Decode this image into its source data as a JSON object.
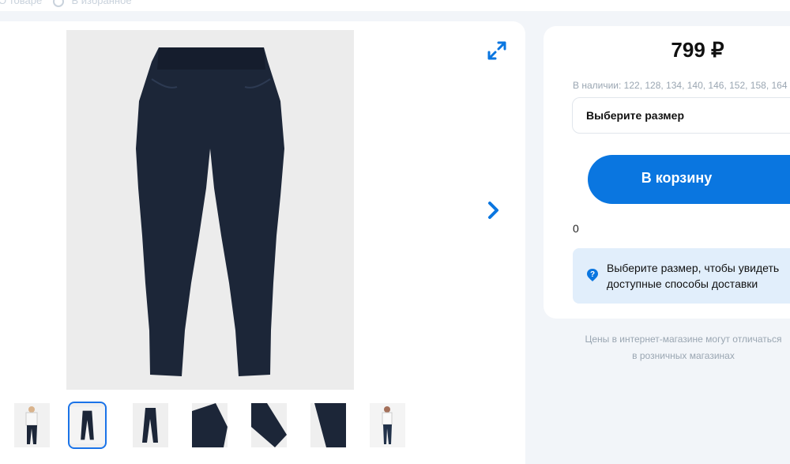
{
  "topbar": {
    "crumb_about": "О товаре",
    "crumb_favorites": "В избранное"
  },
  "gallery": {
    "main_alt": "Navy slim pants",
    "thumbnails": [
      "thumb-1",
      "thumb-2",
      "thumb-3",
      "thumb-4",
      "thumb-5",
      "thumb-6",
      "thumb-7"
    ],
    "active_thumbnail": 2
  },
  "buy": {
    "price": "799 ₽",
    "availability": "В наличии: 122, 128, 134, 140, 146, 152, 158, 164",
    "size_placeholder": "Выберите размер",
    "cart_label": "В корзину",
    "counter": "0",
    "delivery_line1": "Выберите размер, чтобы увидеть",
    "delivery_line2": "доступные способы доставки",
    "disclaimer_line1": "Цены в интернет-магазине могут отличаться",
    "disclaimer_line2": "в розничных магазинах"
  },
  "colors": {
    "accent": "#0a76e0",
    "info_bg": "#e1eefb",
    "pants": "#1c2638"
  }
}
